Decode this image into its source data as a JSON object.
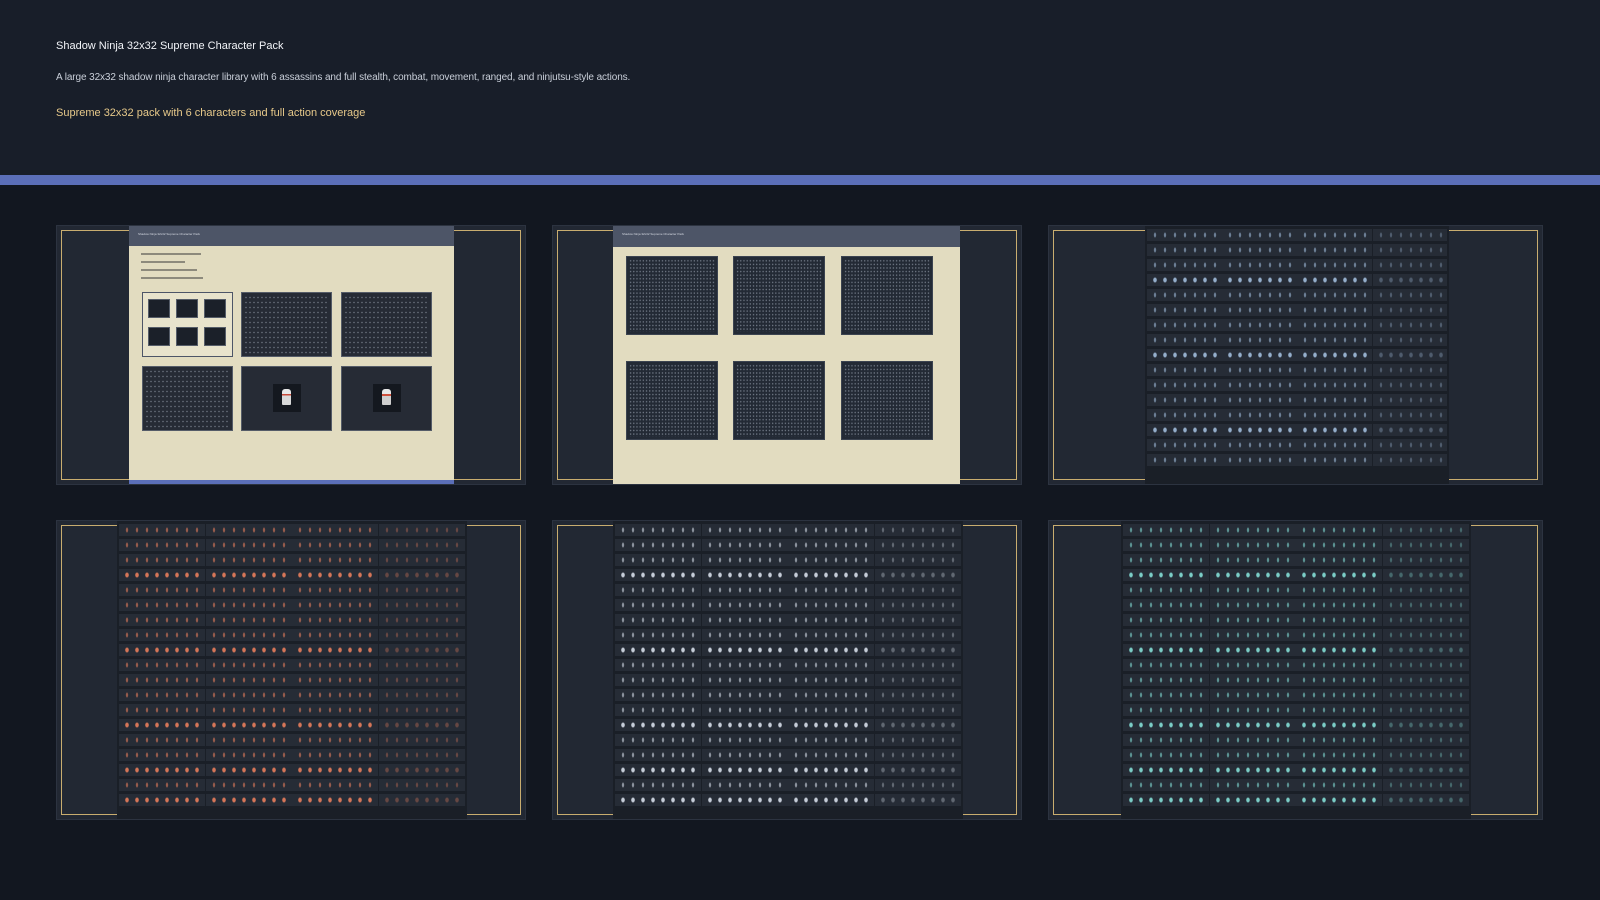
{
  "header": {
    "title": "Shadow Ninja 32x32 Supreme Character Pack",
    "description": "A large 32x32 shadow ninja character library with 6 assassins and full stealth, combat, movement, ranged, and ninjutsu-style actions.",
    "tagline": "Supreme 32x32 pack with 6 characters and full action coverage"
  },
  "colors": {
    "background": "#121720",
    "header_background": "#181e29",
    "accent_bar": "#5b6fb8",
    "tagline": "#e7c98a",
    "frame_border": "#c9ad6f",
    "preview_paper": "#e2dcc0"
  },
  "previews": [
    {
      "kind": "overview",
      "tint": "#c8d2e1"
    },
    {
      "kind": "character-grid",
      "tint": "#8fb0c8"
    },
    {
      "kind": "sprite-sheet",
      "tint": "#9bb6d4"
    },
    {
      "kind": "sprite-sheet",
      "tint": "#e07a5a"
    },
    {
      "kind": "sprite-sheet",
      "tint": "#cfd6e2"
    },
    {
      "kind": "sprite-sheet",
      "tint": "#7fd6cf"
    }
  ]
}
